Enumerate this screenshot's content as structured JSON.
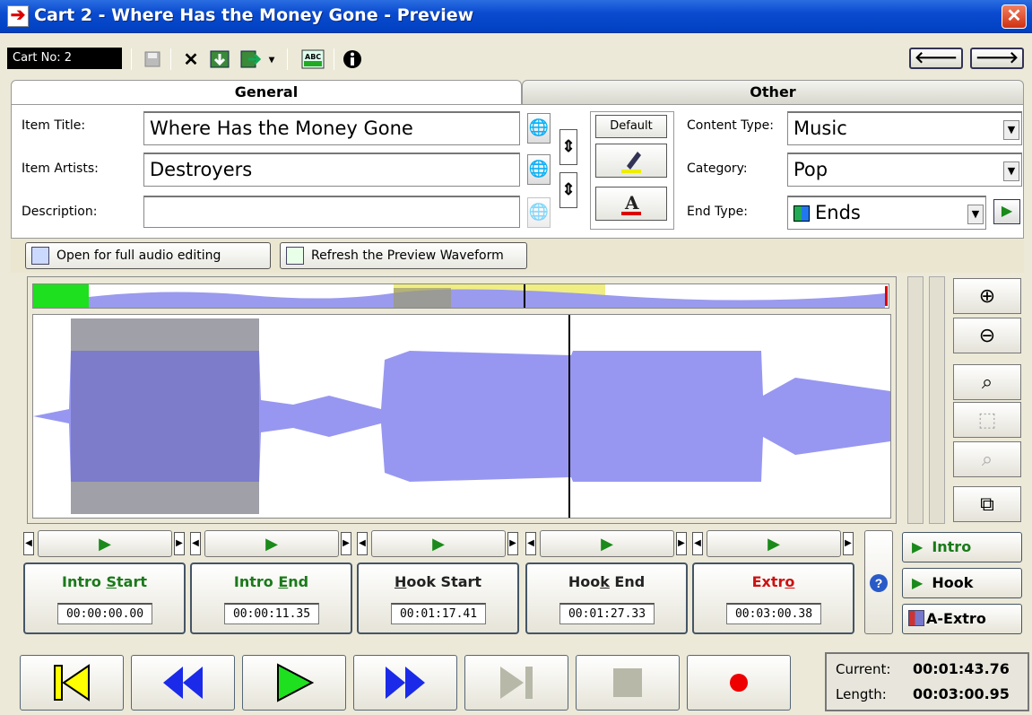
{
  "window": {
    "title": "Cart 2 - Where Has the Money Gone - Preview",
    "close": "✕"
  },
  "toolbar": {
    "cart_no": "Cart No: 2",
    "spell_label": "ABC"
  },
  "tabs": {
    "general": "General",
    "other": "Other"
  },
  "general": {
    "item_title_label": "Item Title:",
    "item_title": "Where Has the Money Gone",
    "item_artists_label": "Item Artists:",
    "item_artists": "Destroyers",
    "description_label": "Description:",
    "description": "",
    "default_label": "Default"
  },
  "other": {
    "content_type_label": "Content Type:",
    "content_type": "Music",
    "category_label": "Category:",
    "category": "Pop",
    "end_type_label": "End Type:",
    "end_type": "Ends"
  },
  "buttons": {
    "open_full": "Open for full audio editing",
    "refresh": "Refresh the Preview Waveform"
  },
  "markers": [
    {
      "label_pre": "Intro ",
      "label_key": "S",
      "label_post": "tart",
      "value": "00:00:00.00",
      "color": "#1a7a1a"
    },
    {
      "label_pre": "Intro ",
      "label_key": "E",
      "label_post": "nd",
      "value": "00:00:11.35",
      "color": "#1a7a1a"
    },
    {
      "label_pre": "",
      "label_key": "H",
      "label_post": "ook Start",
      "value": "00:01:17.41",
      "color": "#222222"
    },
    {
      "label_pre": "Hoo",
      "label_key": "k",
      "label_post": " End",
      "value": "00:01:27.33",
      "color": "#222222"
    },
    {
      "label_pre": "Extr",
      "label_key": "o",
      "label_post": "",
      "value": "00:03:00.38",
      "color": "#cc1111"
    }
  ],
  "side": {
    "intro": "Intro",
    "hook": "Hook",
    "aextro": "A-Extro"
  },
  "status": {
    "current_label": "Current:",
    "current": "00:01:43.76",
    "length_label": "Length:",
    "length": "00:03:00.95"
  }
}
